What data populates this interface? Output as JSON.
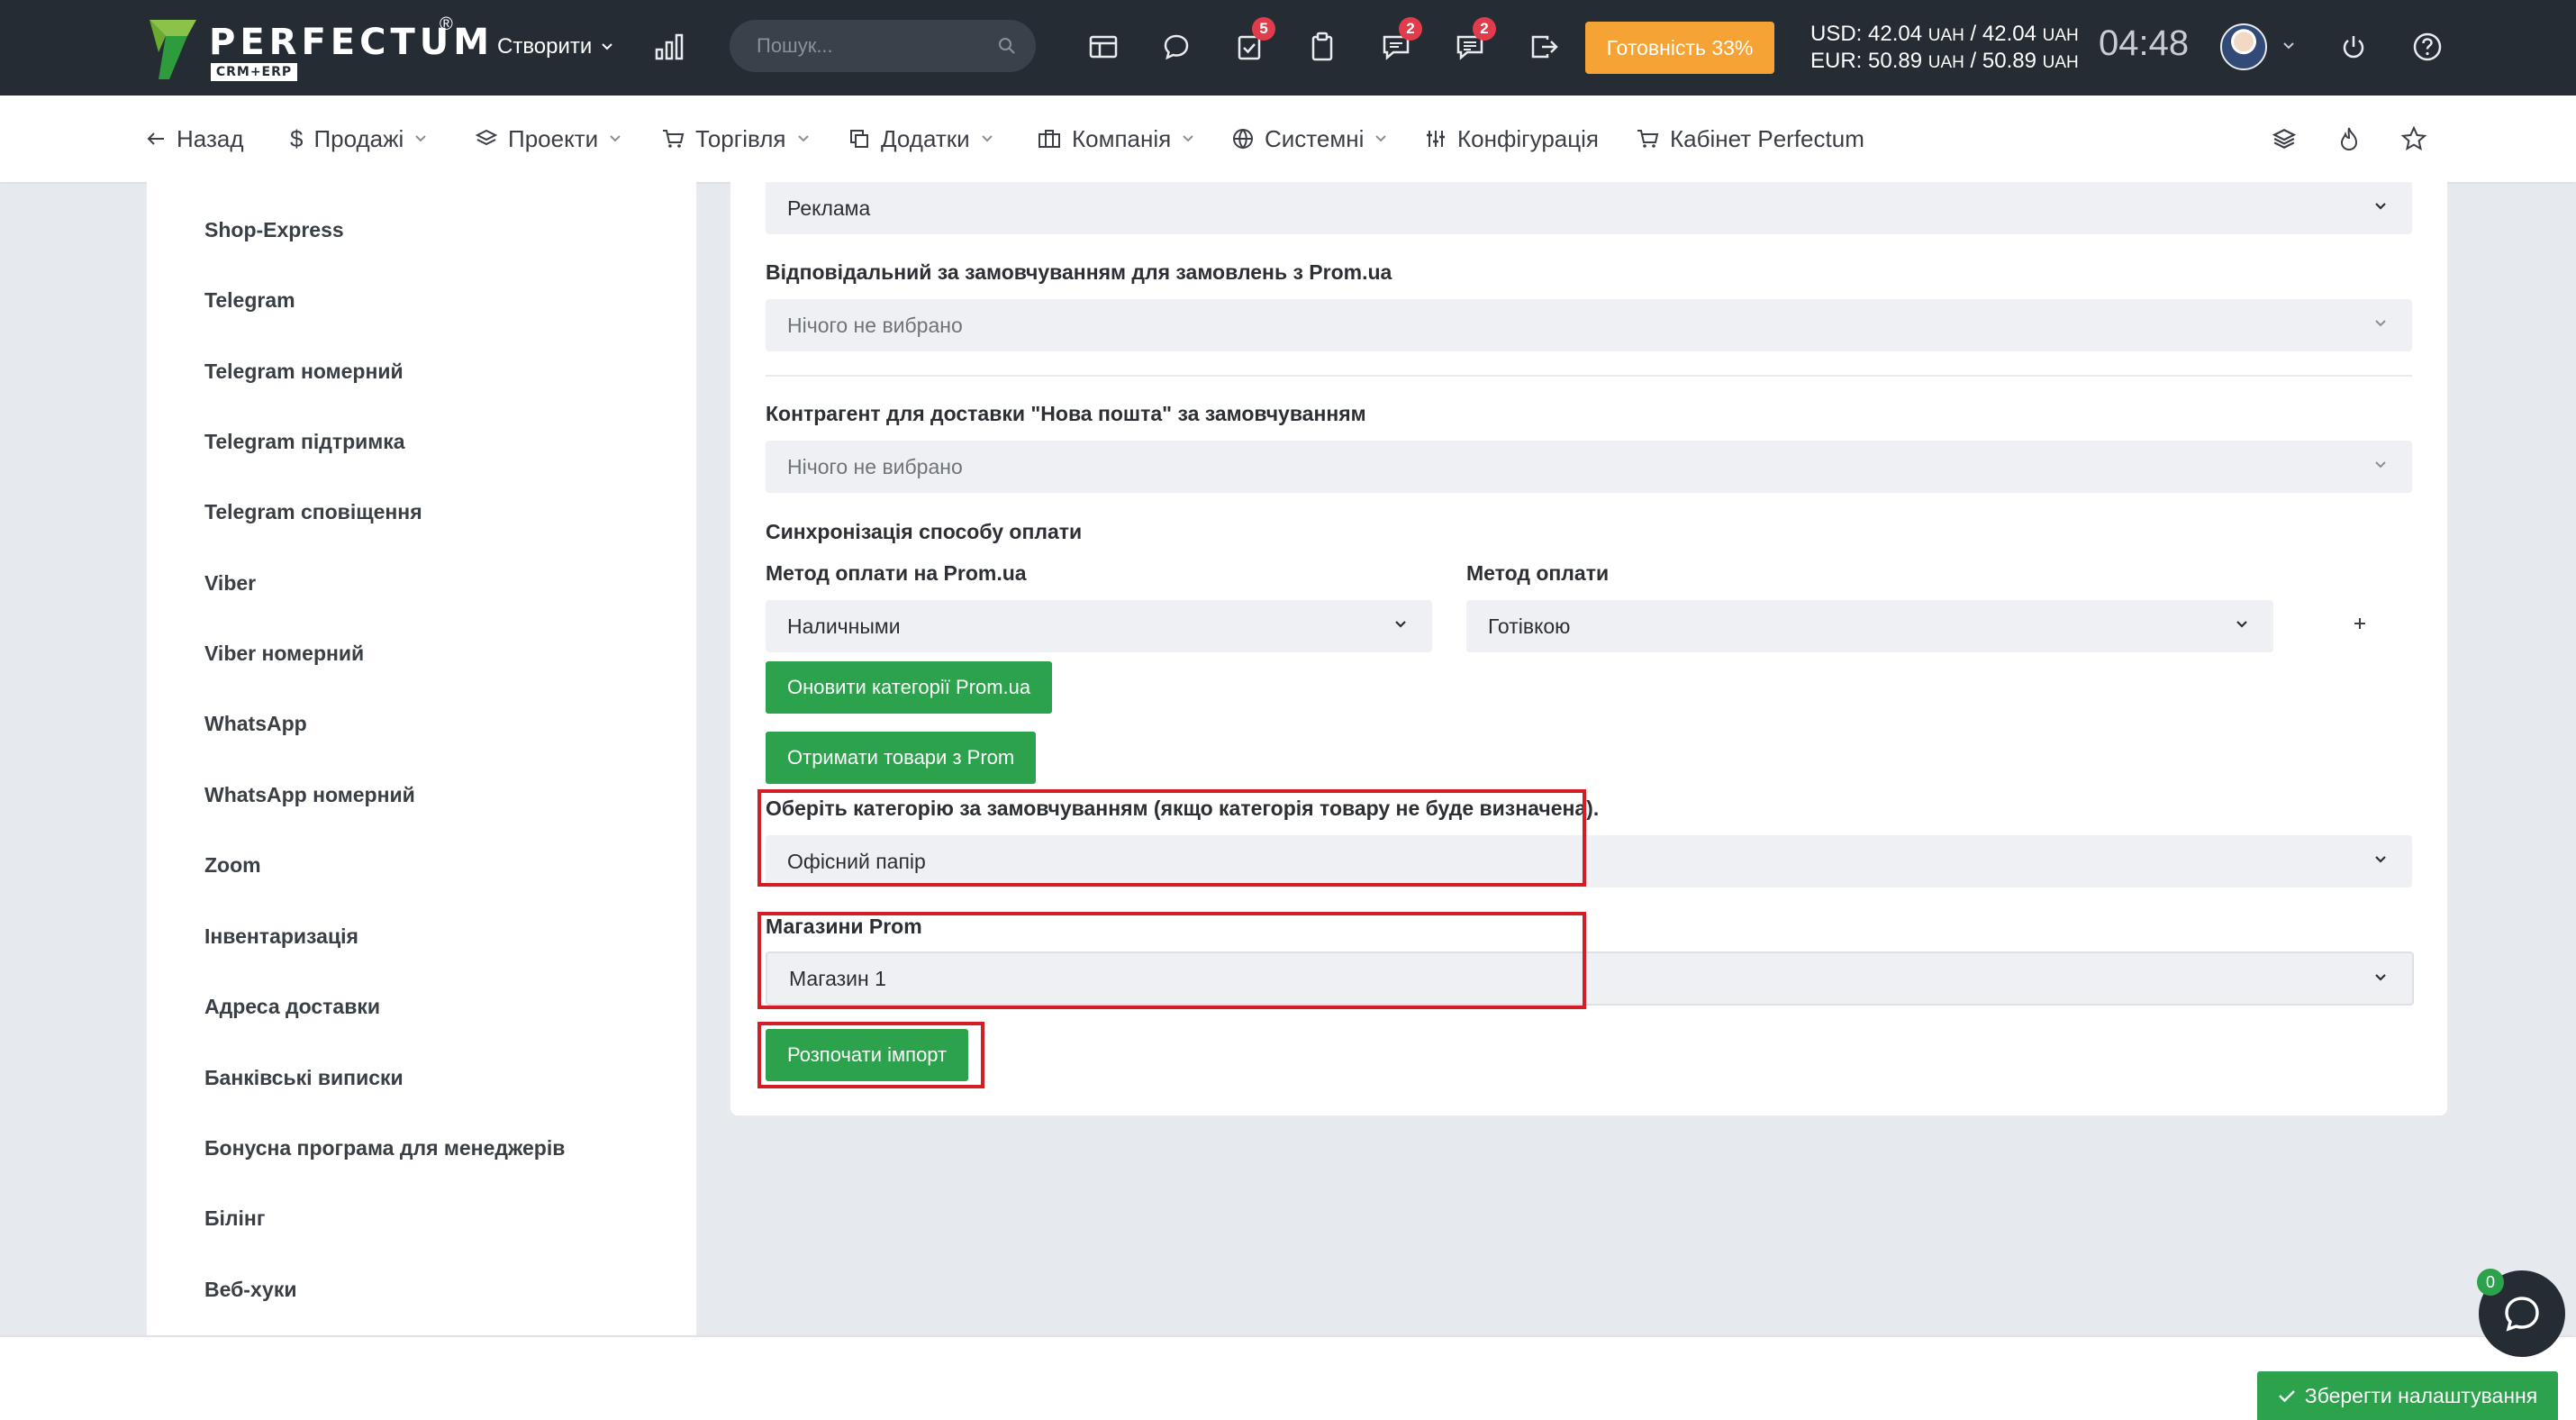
{
  "header": {
    "logo_text": "PERFECTUM",
    "logo_sub": "CRM+ERP",
    "create_label": "Створити",
    "search_placeholder": "Пошук...",
    "badges": {
      "tasks": "5",
      "messages": "2",
      "comments": "2"
    },
    "readiness_label": "Готовність 33%",
    "currency": {
      "usd_label": "USD:",
      "usd_values": "42.04",
      "usd_values2": "42.04",
      "eur_label": "EUR:",
      "eur_values": "50.89",
      "eur_values2": "50.89",
      "unit": "UAH"
    },
    "clock": "04:48",
    "icons": [
      "chart-icon",
      "table-icon",
      "chat-icon",
      "tasks-icon",
      "clipboard-icon",
      "messages-icon",
      "comments-icon",
      "exit-icon",
      "power-icon",
      "help-icon"
    ]
  },
  "nav": {
    "back": "Назад",
    "items": [
      "Продажі",
      "Проекти",
      "Торгівля",
      "Додатки",
      "Компанія",
      "Системні",
      "Конфігурація",
      "Кабінет Perfectum"
    ]
  },
  "sidebar": {
    "items": [
      "Shop-Express",
      "Telegram",
      "Telegram номерний",
      "Telegram підтримка",
      "Telegram сповіщення",
      "Viber",
      "Viber номерний",
      "WhatsApp",
      "WhatsApp номерний",
      "Zoom",
      "Інвентаризація",
      "Адреса доставки",
      "Банківські виписки",
      "Бонусна програма для менеджерів",
      "Білінг",
      "Веб-хуки"
    ]
  },
  "form": {
    "source_value": "Реклама",
    "responsible_label": "Відповідальний за замовчуванням для замовлень з Prom.ua",
    "responsible_value": "Нічого не вибрано",
    "contractor_label": "Контрагент для доставки \"Нова пошта\" за замовчуванням",
    "contractor_value": "Нічого не вибрано",
    "payment_sync_label": "Синхронізація способу оплати",
    "prom_method_label": "Метод оплати на Prom.ua",
    "prom_method_value": "Наличными",
    "method_label": "Метод оплати",
    "method_value": "Готівкою",
    "plus_label": "+",
    "update_categories_btn": "Оновити категорії Prom.ua",
    "get_products_btn": "Отримати товари з Prom",
    "default_category_label": "Оберіть категорію за замовчуванням (якщо категорія товару не буде визначена).",
    "default_category_value": "Офісний папір",
    "stores_label": "Магазини Prom",
    "stores_value": "Магазин 1",
    "start_import_btn": "Розпочати імпорт"
  },
  "footer": {
    "save_label": "Зберегти налаштування",
    "chat_badge": "0"
  },
  "colors": {
    "topbar": "#262c34",
    "accent_green": "#2ba24b",
    "readiness_orange": "#f5a334",
    "badge_red": "#e03c4b",
    "highlight_red": "#d41e26"
  }
}
